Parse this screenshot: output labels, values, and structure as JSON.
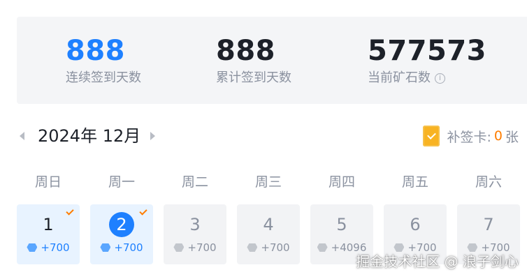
{
  "stats": [
    {
      "value": "888",
      "label": "连续签到天数",
      "highlight": true
    },
    {
      "value": "888",
      "label": "累计签到天数",
      "highlight": false
    },
    {
      "value": "577573",
      "label": "当前矿石数",
      "info_icon": "info-icon"
    }
  ],
  "calendar": {
    "month_label": "2024年 12月",
    "prev_icon": "caret-left-icon",
    "next_icon": "caret-right-icon",
    "makeup_card": {
      "icon": "makeup-card-icon",
      "label": "补签卡:",
      "count": "0",
      "unit": "张"
    },
    "weekdays": [
      "周日",
      "周一",
      "周二",
      "周三",
      "周四",
      "周五",
      "周六"
    ],
    "days": [
      {
        "day": "1",
        "reward": "+700",
        "signed": true
      },
      {
        "day": "2",
        "reward": "+700",
        "signed": true,
        "today": true
      },
      {
        "day": "3",
        "reward": "+700",
        "signed": false
      },
      {
        "day": "4",
        "reward": "+700",
        "signed": false
      },
      {
        "day": "5",
        "reward": "+4096",
        "signed": false
      },
      {
        "day": "6",
        "reward": "+700",
        "signed": false
      },
      {
        "day": "7",
        "reward": "+700",
        "signed": false
      }
    ]
  },
  "colors": {
    "accent": "#1e80ff",
    "orange": "#ff7d00",
    "muted": "#8a919f"
  },
  "watermark": "掘金技术社区 @ 浪子剑心"
}
